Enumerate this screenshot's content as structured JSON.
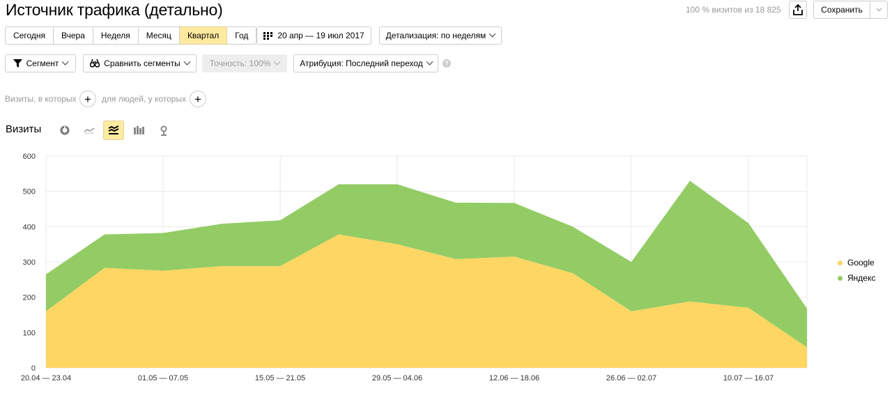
{
  "header": {
    "title": "Источник трафика (детально)",
    "visits_info": "100 % визитов из 18 825",
    "save_label": "Сохранить"
  },
  "toolbar": {
    "periods": [
      {
        "label": "Сегодня",
        "active": false
      },
      {
        "label": "Вчера",
        "active": false
      },
      {
        "label": "Неделя",
        "active": false
      },
      {
        "label": "Месяц",
        "active": false
      },
      {
        "label": "Квартал",
        "active": true
      },
      {
        "label": "Год",
        "active": false
      }
    ],
    "date_range": "20 апр — 19 июл 2017",
    "detail_label": "Детализация: по неделям"
  },
  "filters": {
    "segment_label": "Сегмент",
    "compare_label": "Сравнить сегменты",
    "accuracy_label": "Точность: 100%",
    "attribution_label": "Атрибуция: Последний переход",
    "help": "?",
    "visits_where": "Визиты, в которых",
    "people_where": "для людей, у которых"
  },
  "chart_section": {
    "heading": "Визиты",
    "view_icons": [
      "pie-chart-icon",
      "line-chart-icon",
      "stacked-area-icon",
      "bar-chart-icon",
      "map-pin-icon"
    ],
    "active_view": "stacked-area-icon"
  },
  "colors": {
    "google": "#fdd663",
    "yandex": "#93cc65",
    "accent": "#ffeba0",
    "grid": "#e8e8e8"
  },
  "chart_data": {
    "type": "area",
    "stacked": true,
    "x_tick_labels": [
      "20.04 — 23.04",
      "01.05 — 07.05",
      "15.05 — 21.05",
      "29.05 — 04.06",
      "12.06 — 18.06",
      "26.06 — 02.07",
      "10.07 — 16.07"
    ],
    "ylim": [
      0,
      600
    ],
    "yticks": [
      0,
      100,
      200,
      300,
      400,
      500,
      600
    ],
    "grid": true,
    "legend_position": "right",
    "series": [
      {
        "name": "Google",
        "values": [
          160,
          283,
          275,
          288,
          288,
          378,
          350,
          308,
          315,
          268,
          160,
          188,
          170,
          58
        ]
      },
      {
        "name": "Яндекс",
        "values": [
          105,
          95,
          107,
          120,
          130,
          142,
          170,
          160,
          152,
          132,
          140,
          342,
          240,
          110
        ]
      }
    ]
  }
}
